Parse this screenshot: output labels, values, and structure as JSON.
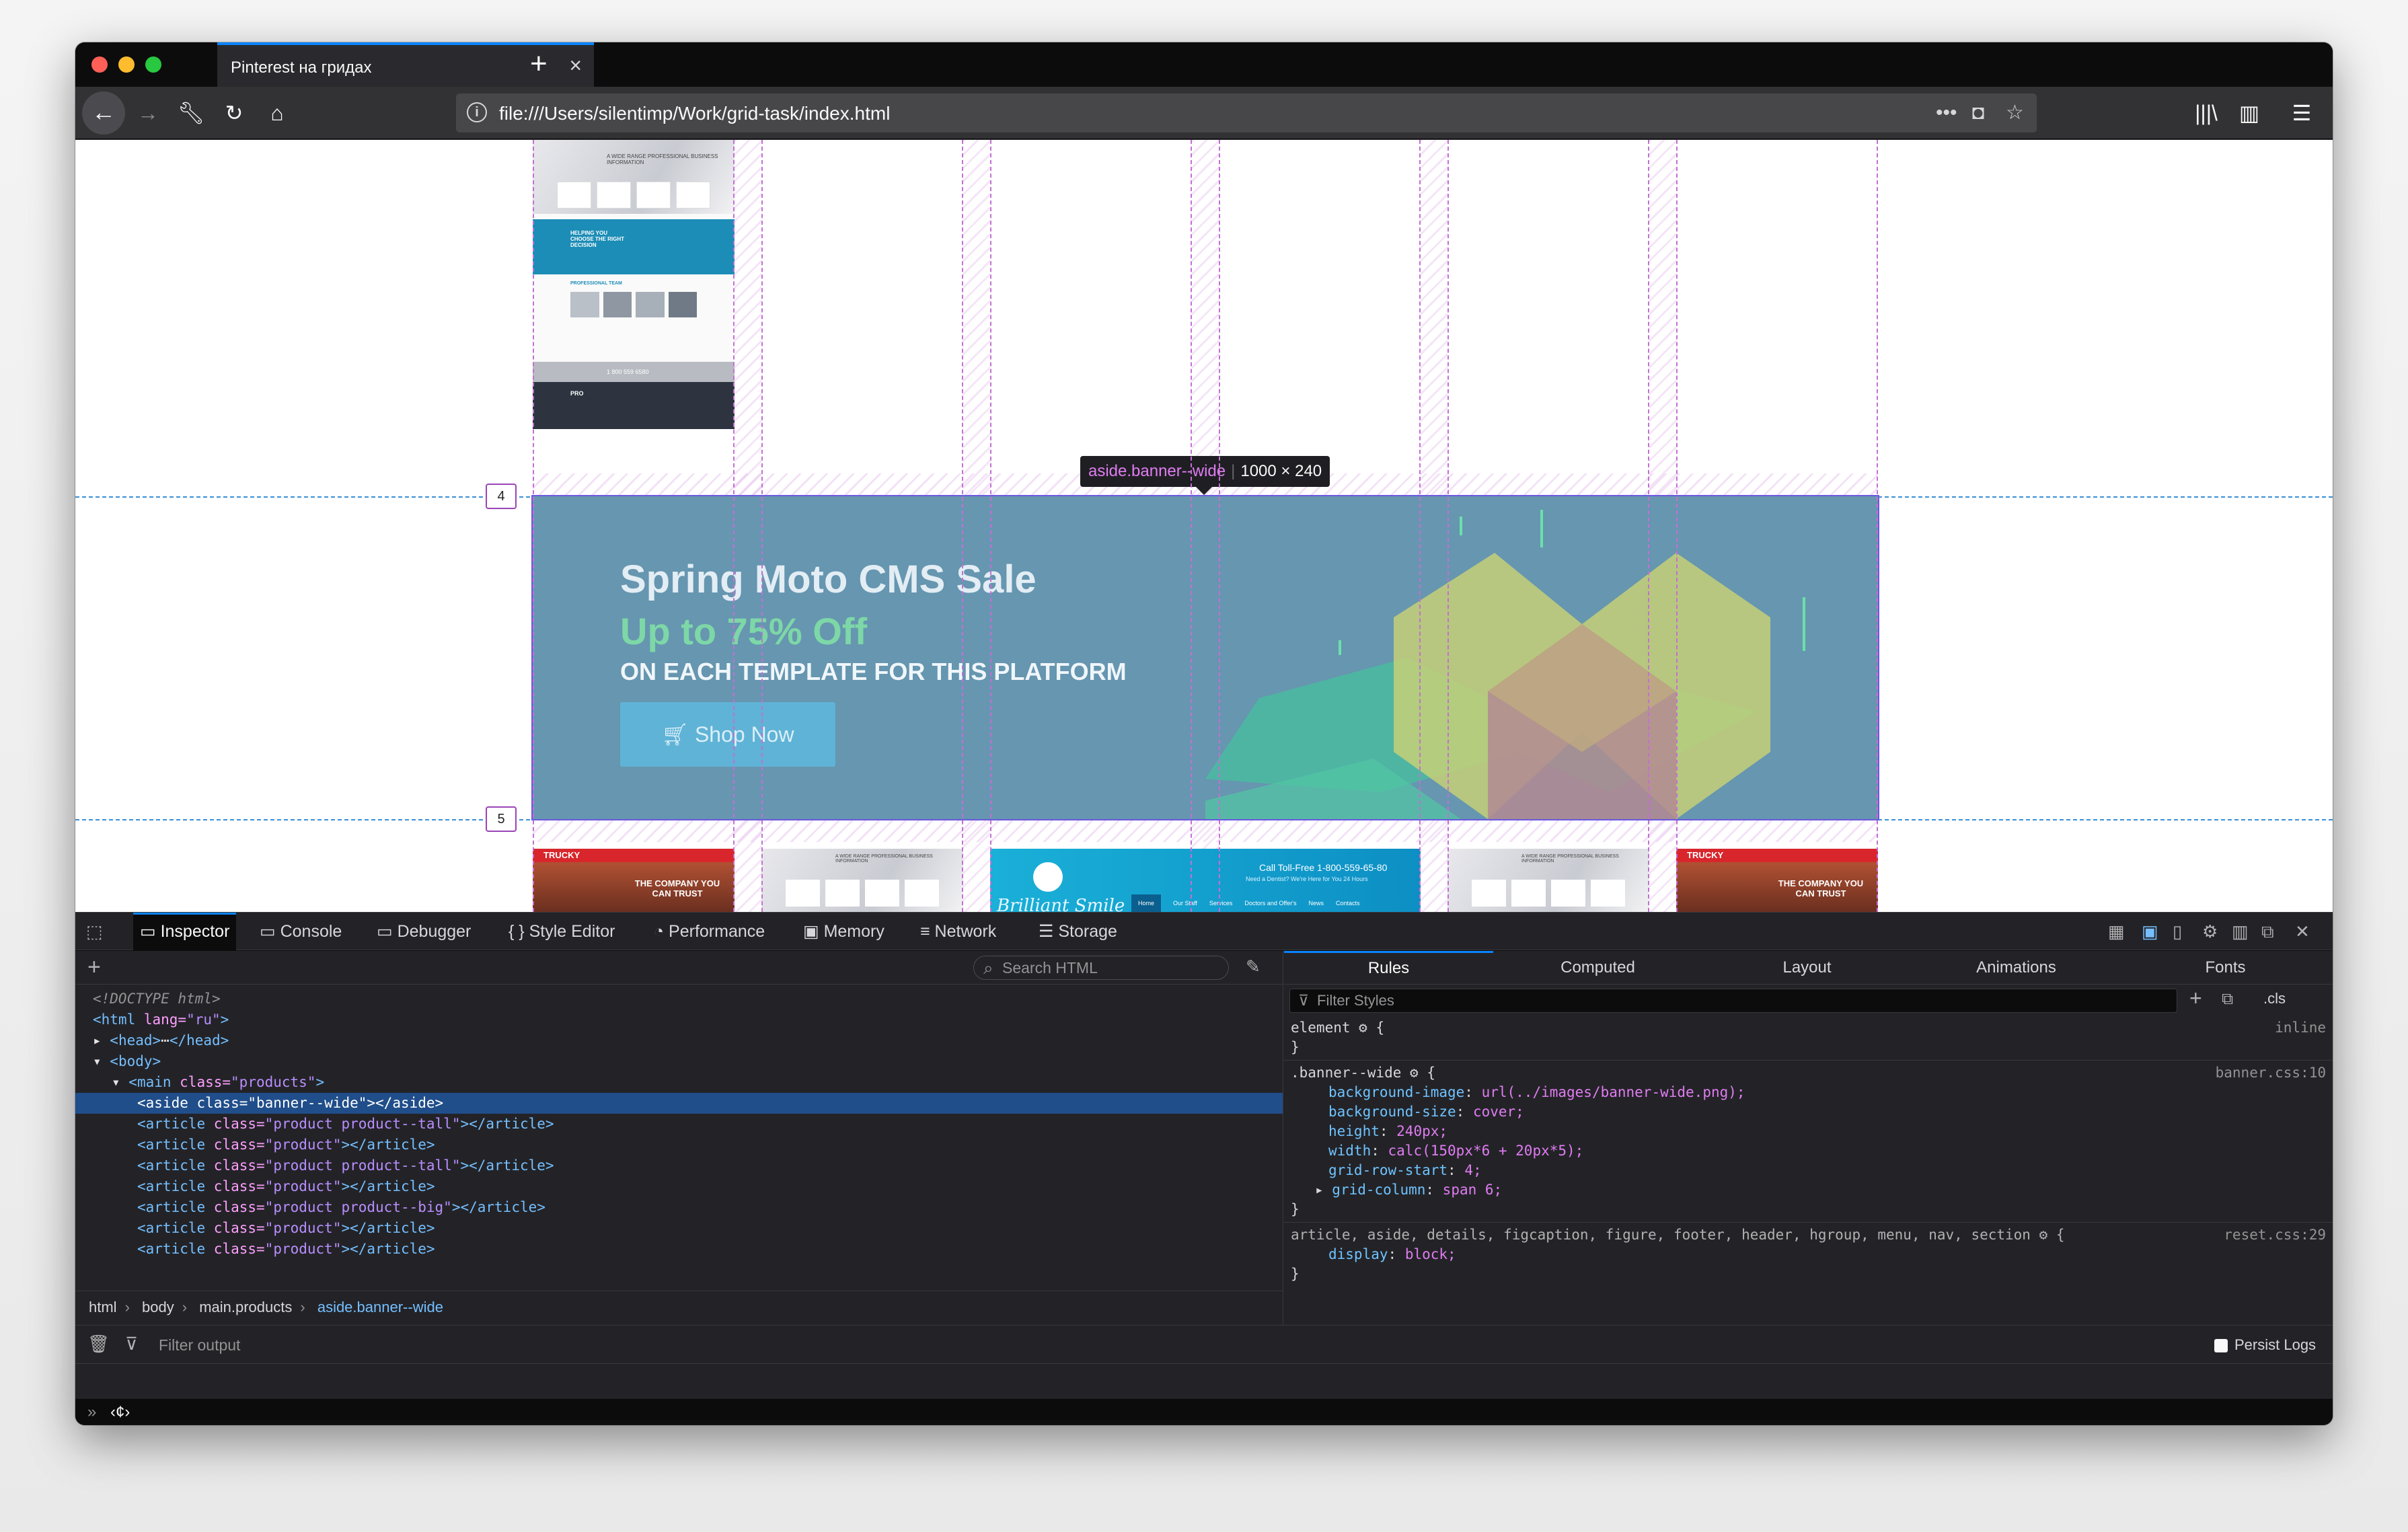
{
  "browser": {
    "tab_title": "Pinterest на гридах",
    "url": "file:///Users/silentimp/Work/grid-task/index.html"
  },
  "overlay": {
    "tooltip_selector": "aside.banner--wide",
    "tooltip_dims": "1000 × 240",
    "line_4": "4",
    "line_5": "5"
  },
  "banner": {
    "title": "Spring Moto CMS Sale",
    "subtitle": "Up to 75% Off",
    "line3": "ON EACH TEMPLATE FOR THIS PLATFORM",
    "button": "Shop Now"
  },
  "thumbs": {
    "trucky_logo": "TRUCKY",
    "trucky_tagline": "THE COMPANY YOU CAN TRUST",
    "smile_brand": "Brilliant Smile",
    "smile_phone": "Call Toll-Free  1-800-559-65-80",
    "smile_sub": "Need a Dentist? We're Here for You 24 Hours",
    "smile_nav": [
      "Home",
      "Our Staff",
      "Services",
      "Doctors and Offer's",
      "News",
      "Contacts"
    ],
    "pro_title": "A WIDE RANGE PROFESSIONAL BUSINESS INFORMATION",
    "pro_logo": "PRO",
    "pro_phone": "1 800 559 6580",
    "pro_helping": "HELPING YOU CHOOSE THE RIGHT DECISION",
    "pro_team": "PROFESSIONAL TEAM"
  },
  "devtools": {
    "tabs": [
      "Inspector",
      "Console",
      "Debugger",
      "Style Editor",
      "Performance",
      "Memory",
      "Network",
      "Storage"
    ],
    "search_placeholder": "Search HTML",
    "side_tabs": [
      "Rules",
      "Computed",
      "Layout",
      "Animations",
      "Fonts"
    ],
    "filter_placeholder": "Filter Styles",
    "cls_label": ".cls",
    "tree": {
      "doctype": "<!DOCTYPE html>",
      "html_open": "<html",
      "html_lang_attr": " lang=",
      "html_lang_val": "\"ru\"",
      "html_close": ">",
      "head_open": "<head>",
      "head_ellipsis": "⋯",
      "head_close": "</head>",
      "body": "<body>",
      "main_open": "<main",
      "class_attr": " class=",
      "main_class": "\"products\"",
      "gt": ">",
      "aside_open": "<aside",
      "aside_class": "\"banner--wide\"",
      "aside_close": "></aside>",
      "article_open": "<article",
      "article_close": "></article>",
      "article_classes": [
        "\"product product--tall\"",
        "\"product\"",
        "\"product product--tall\"",
        "\"product\"",
        "\"product product--big\"",
        "\"product\"",
        "\"product\""
      ]
    },
    "breadcrumbs": [
      "html",
      "body",
      "main.products",
      "aside.banner--wide"
    ],
    "rules": {
      "element_selector": "element",
      "element_source": "inline",
      "banner_selector": ".banner--wide",
      "banner_source": "banner.css:10",
      "banner_props": [
        {
          "name": "background-image",
          "value": "url(../images/banner-wide.png);"
        },
        {
          "name": "background-size",
          "value": "cover;"
        },
        {
          "name": "height",
          "value": "240px;"
        },
        {
          "name": "width",
          "value": "calc(150px*6 + 20px*5);"
        },
        {
          "name": "grid-row-start",
          "value": "4;"
        },
        {
          "name": "grid-column",
          "value": "span 6;"
        }
      ],
      "reset_selector": "article, aside, details, figcaption, figure, footer, header, hgroup, menu, nav, section",
      "reset_source": "reset.css:29",
      "reset_props": [
        {
          "name": "display",
          "value": "block;"
        }
      ],
      "open_brace": "{",
      "close_brace": "}",
      "colon": ": "
    },
    "console": {
      "filter_placeholder": "Filter output",
      "persist_logs": "Persist Logs",
      "prompt": "»",
      "input_glyph": "‹¢›"
    }
  }
}
